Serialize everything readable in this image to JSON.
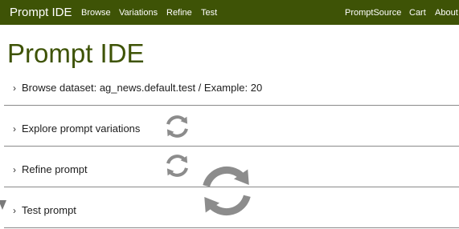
{
  "navbar": {
    "brand": "Prompt IDE",
    "links": [
      "Browse",
      "Variations",
      "Refine",
      "Test"
    ],
    "right_links": [
      "PromptSource",
      "Cart",
      "About"
    ]
  },
  "page_title": "Prompt IDE",
  "sections": [
    {
      "caret": "›",
      "label": "Browse dataset: ag_news.default.test / Example: 20"
    },
    {
      "caret": "›",
      "label": "Explore prompt variations"
    },
    {
      "caret": "›",
      "label": "Refine prompt"
    },
    {
      "caret": "›",
      "label": "Test prompt"
    }
  ],
  "icons": {
    "loading": "refresh-spinner-icon",
    "corner": "corner-arrow-icon"
  },
  "colors": {
    "navbar_bg": "#3e5306",
    "title": "#3e5306",
    "spinner": "#8c8c8c",
    "divider": "#8a8a8a"
  }
}
